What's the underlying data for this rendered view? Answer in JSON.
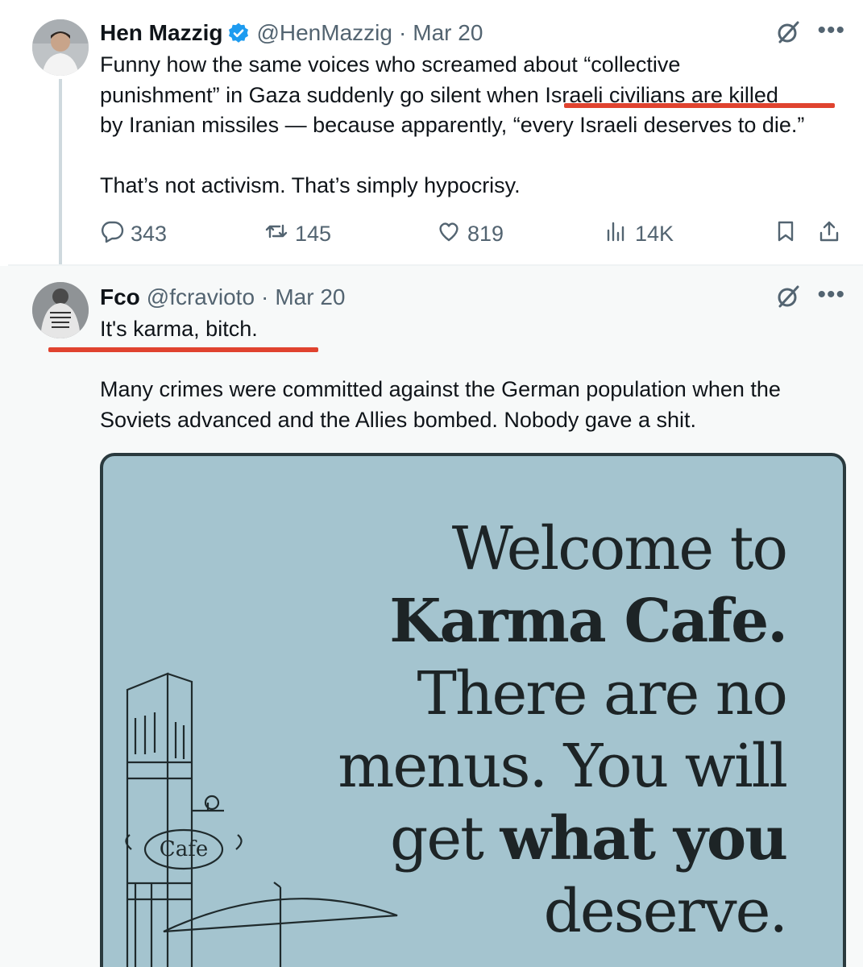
{
  "tweet1": {
    "name": "Hen Mazzig",
    "handle": "@HenMazzig",
    "sep": "·",
    "date": "Mar 20",
    "lines": [
      "Funny how the same voices who screamed about “collective",
      "punishment” in Gaza suddenly go silent when Israeli civilians are killed",
      "by Iranian missiles — because apparently, “every Israeli deserves to die.”"
    ],
    "line2": "That’s not activism. That’s simply hypocrisy.",
    "reply_count": "343",
    "repost_count": "145",
    "like_count": "819",
    "view_count": "14K"
  },
  "tweet2": {
    "name": "Fco",
    "handle": "@fcravioto",
    "sep": "·",
    "date": "Mar 20",
    "text": "It's karma, bitch.",
    "lines2": [
      "Many crimes were committed against the German population when the",
      "Soviets advanced and the Allies bombed. Nobody gave a shit."
    ]
  },
  "meme": {
    "lines": [
      "Welcome to",
      "Karma Cafe.",
      "There are no",
      "menus. You will"
    ],
    "last_pre": "get ",
    "last_bold": "what you",
    "final": "deserve.",
    "sign": "Cafe"
  },
  "colors": {
    "accent_red": "#e0432f",
    "verified_blue": "#1d9bf0",
    "muted": "#536471",
    "meme_bg": "#a4c4cf"
  },
  "icons": [
    "verified-badge-icon",
    "grok-icon",
    "more-icon",
    "reply-icon",
    "repost-icon",
    "like-icon",
    "views-icon",
    "bookmark-icon",
    "share-icon"
  ]
}
